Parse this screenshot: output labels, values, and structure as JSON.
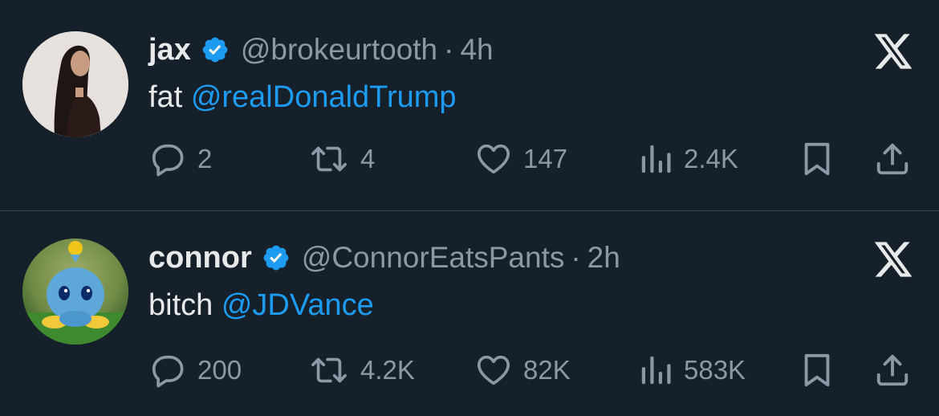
{
  "colors": {
    "background": "#15202b",
    "mention": "#1d9bf0",
    "muted": "#8b98a5",
    "text": "#e7e9ea",
    "verified": "#1d9bf0"
  },
  "tweets": [
    {
      "name": "jax",
      "handle": "@brokeurtooth",
      "separator": "·",
      "time": "4h",
      "text": "fat",
      "mention": "@realDonaldTrump",
      "stats": {
        "replies": "2",
        "reposts": "4",
        "likes": "147",
        "views": "2.4K"
      }
    },
    {
      "name": "connor",
      "handle": "@ConnorEatsPants",
      "separator": "·",
      "time": "2h",
      "text": "bitch",
      "mention": "@JDVance",
      "stats": {
        "replies": "200",
        "reposts": "4.2K",
        "likes": "82K",
        "views": "583K"
      }
    }
  ]
}
